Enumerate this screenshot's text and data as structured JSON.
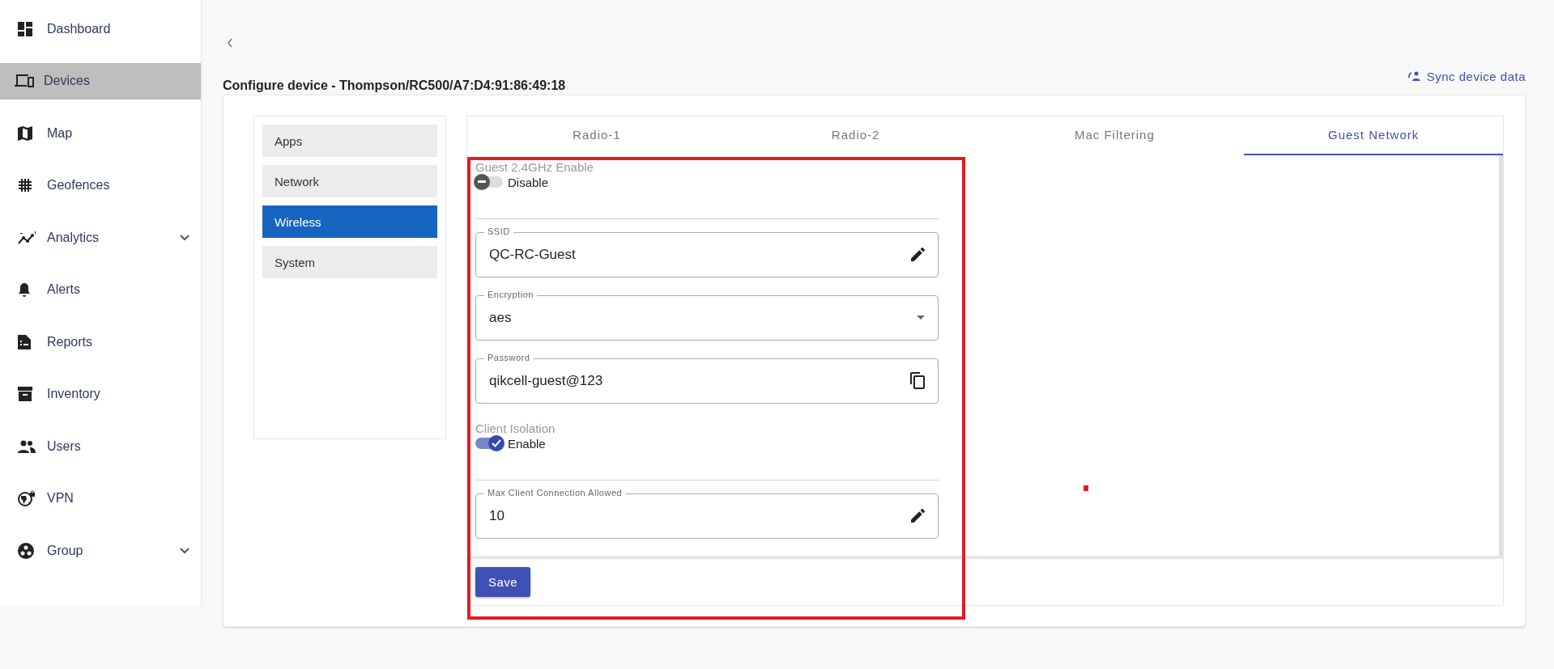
{
  "sidebar": {
    "items": [
      {
        "label": "Dashboard",
        "selected": false,
        "expandable": false
      },
      {
        "label": "Devices",
        "selected": true,
        "expandable": false
      },
      {
        "label": "Map",
        "selected": false,
        "expandable": false
      },
      {
        "label": "Geofences",
        "selected": false,
        "expandable": false
      },
      {
        "label": "Analytics",
        "selected": false,
        "expandable": true
      },
      {
        "label": "Alerts",
        "selected": false,
        "expandable": false
      },
      {
        "label": "Reports",
        "selected": false,
        "expandable": false
      },
      {
        "label": "Inventory",
        "selected": false,
        "expandable": false
      },
      {
        "label": "Users",
        "selected": false,
        "expandable": false
      },
      {
        "label": "VPN",
        "selected": false,
        "expandable": false
      },
      {
        "label": "Group",
        "selected": false,
        "expandable": true
      }
    ]
  },
  "page": {
    "title": "Configure device - Thompson/RC500/A7:D4:91:86:49:18",
    "sync_action": "Sync device data"
  },
  "config_menu": [
    {
      "label": "Apps",
      "selected": false
    },
    {
      "label": "Network",
      "selected": false
    },
    {
      "label": "Wireless",
      "selected": true
    },
    {
      "label": "System",
      "selected": false
    }
  ],
  "tabs": [
    {
      "label": "Radio-1",
      "selected": false
    },
    {
      "label": "Radio-2",
      "selected": false
    },
    {
      "label": "Mac Filtering",
      "selected": false
    },
    {
      "label": "Guest Network",
      "selected": true
    }
  ],
  "form": [
    {
      "kind": "toggle",
      "label": "Guest 2.4GHz Enable",
      "on": false,
      "state_text": "Disable"
    },
    {
      "kind": "edit_field",
      "label": "SSID",
      "value": "QC-RC-Guest"
    },
    {
      "kind": "select_field",
      "label": "Encryption",
      "value": "aes"
    },
    {
      "kind": "copy_field",
      "label": "Password",
      "value": "qikcell-guest@123"
    },
    {
      "kind": "toggle",
      "label": "Client Isolation",
      "on": true,
      "state_text": "Enable"
    },
    {
      "kind": "edit_field",
      "label": "Max Client Connection Allowed",
      "value": "10"
    }
  ],
  "save_button": "Save"
}
